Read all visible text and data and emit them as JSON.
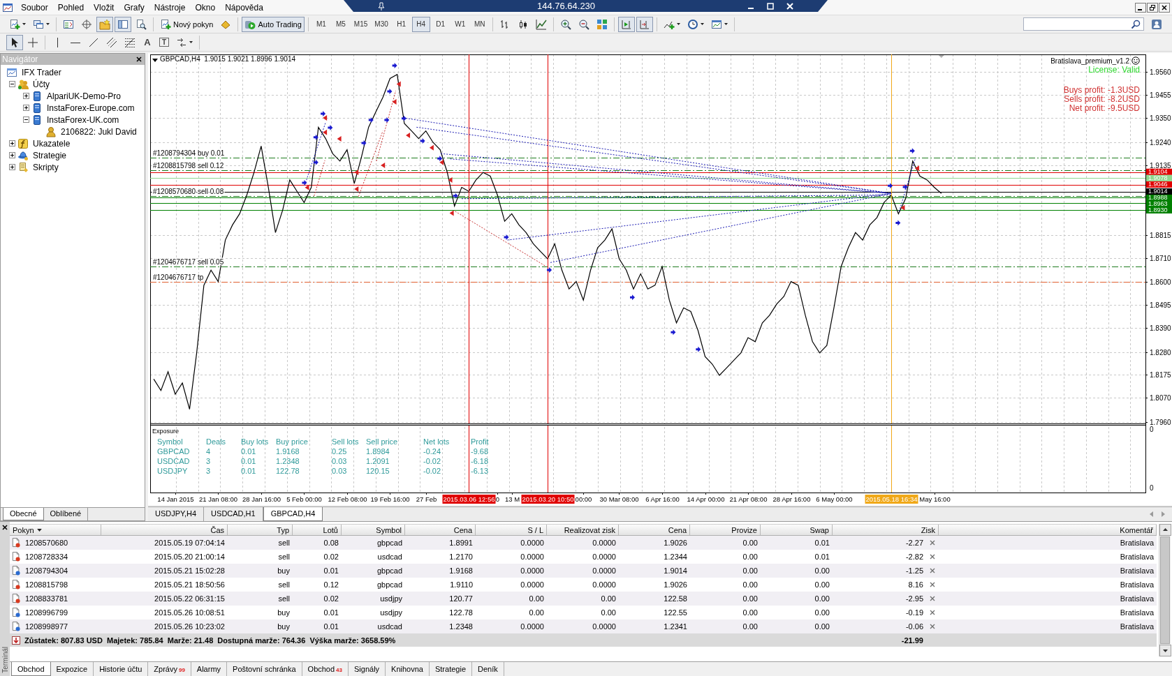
{
  "window": {
    "menu": [
      "Soubor",
      "Pohled",
      "Vložit",
      "Grafy",
      "Nástroje",
      "Okno",
      "Nápověda"
    ],
    "remote_title": "144.76.64.230"
  },
  "toolbar": [
    [
      {
        "kind": "icon",
        "caret": true,
        "pressed": false
      },
      {
        "kind": "icon",
        "caret": true,
        "pressed": false
      }
    ],
    [
      {
        "kind": "icon",
        "caret": false,
        "pressed": false
      },
      {
        "kind": "icon",
        "caret": false,
        "pressed": false
      },
      {
        "kind": "icon",
        "caret": false,
        "pressed": true
      },
      {
        "kind": "icon",
        "caret": false,
        "pressed": true
      },
      {
        "kind": "icon",
        "caret": false,
        "pressed": false
      }
    ],
    [
      {
        "kind": "labeled",
        "label": "Nový pokyn",
        "caret": false,
        "pressed": false
      },
      {
        "kind": "icon",
        "caret": false,
        "pressed": false
      }
    ],
    [
      {
        "kind": "labeled",
        "label": "Auto Trading",
        "caret": false,
        "pressed": true
      }
    ],
    [
      {
        "kind": "timeframe",
        "label": "M1",
        "selected": false
      },
      {
        "kind": "timeframe",
        "label": "M5",
        "selected": false
      },
      {
        "kind": "timeframe",
        "label": "M15",
        "selected": false
      },
      {
        "kind": "timeframe",
        "label": "M30",
        "selected": false
      },
      {
        "kind": "timeframe",
        "label": "H1",
        "selected": false
      },
      {
        "kind": "timeframe",
        "label": "H4",
        "selected": true
      },
      {
        "kind": "timeframe",
        "label": "D1",
        "selected": false
      },
      {
        "kind": "timeframe",
        "label": "W1",
        "selected": false
      },
      {
        "kind": "timeframe",
        "label": "MN",
        "selected": false
      }
    ],
    [
      {
        "kind": "icon",
        "caret": false,
        "pressed": false
      },
      {
        "kind": "icon",
        "caret": false,
        "pressed": false
      },
      {
        "kind": "icon",
        "caret": false,
        "pressed": false
      }
    ],
    [
      {
        "kind": "icon",
        "caret": false,
        "pressed": false
      },
      {
        "kind": "icon",
        "caret": false,
        "pressed": false
      },
      {
        "kind": "icon",
        "caret": false,
        "pressed": false
      }
    ],
    [
      {
        "kind": "icon",
        "caret": false,
        "pressed": true
      },
      {
        "kind": "icon",
        "caret": false,
        "pressed": true
      }
    ],
    [
      {
        "kind": "icon",
        "caret": true,
        "pressed": false
      },
      {
        "kind": "icon",
        "caret": true,
        "pressed": false
      },
      {
        "kind": "icon",
        "caret": true,
        "pressed": false
      }
    ]
  ],
  "drawing_tools": [
    [
      {
        "kind": "icon",
        "caret": false,
        "pressed": true
      },
      {
        "kind": "icon",
        "caret": false,
        "pressed": false
      }
    ],
    [
      {
        "kind": "icon",
        "caret": false,
        "pressed": false
      },
      {
        "kind": "icon",
        "caret": false,
        "pressed": false
      },
      {
        "kind": "icon",
        "caret": false,
        "pressed": false
      },
      {
        "kind": "icon",
        "caret": false,
        "pressed": false
      },
      {
        "kind": "icon",
        "caret": false,
        "pressed": false
      },
      {
        "kind": "glyph",
        "label": "A",
        "caret": false,
        "pressed": false
      },
      {
        "kind": "boxed",
        "label": "T",
        "caret": false,
        "pressed": false
      },
      {
        "kind": "icon",
        "caret": true,
        "pressed": false
      }
    ]
  ],
  "navigator": {
    "title": "Navigátor",
    "tree": [
      {
        "label": "IFX Trader",
        "kind": "terminal",
        "children": [
          {
            "label": "Účty",
            "kind": "accounts",
            "expanded": true,
            "children": [
              {
                "label": "AlpariUK-Demo-Pro",
                "kind": "server",
                "expanded": false
              },
              {
                "label": "InstaForex-Europe.com",
                "kind": "server",
                "expanded": false
              },
              {
                "label": "InstaForex-UK.com",
                "kind": "server",
                "expanded": true,
                "children": [
                  {
                    "label": "2106822: Jukl David",
                    "kind": "account"
                  }
                ]
              }
            ]
          },
          {
            "label": "Ukazatele",
            "kind": "indicators",
            "expanded": false
          },
          {
            "label": "Strategie",
            "kind": "experts",
            "expanded": false
          },
          {
            "label": "Skripty",
            "kind": "scripts",
            "expanded": false
          }
        ]
      }
    ],
    "tabs": [
      {
        "label": "Obecné",
        "selected": true
      },
      {
        "label": "Oblíbené",
        "selected": false
      }
    ]
  },
  "chart": {
    "tabs": [
      {
        "label": "USDJPY,H4",
        "selected": false
      },
      {
        "label": "USDCAD,H1",
        "selected": false
      },
      {
        "label": "GBPCAD,H4",
        "selected": true
      }
    ],
    "indicator": {
      "name": "Bratislava_premium_v1.2",
      "status": "License: Valid",
      "lines": [
        "Buys profit: -1.3USD",
        "Sells profit: -8.2USD",
        "Net profit: -9.5USD"
      ]
    },
    "chart_data": {
      "type": "line",
      "title": "GBPCAD,H4  1.9015 1.9021 1.8996 1.9014",
      "categories": [
        null,
        null,
        null,
        "14 Jan 2015",
        null,
        null,
        null,
        null,
        null,
        "21 Jan 08:00",
        null,
        null,
        null,
        null,
        null,
        "28 Jan 16:00",
        null,
        null,
        null,
        null,
        null,
        "5 Feb 00:00",
        null,
        null,
        null,
        null,
        null,
        "12 Feb 08:00",
        null,
        null,
        null,
        null,
        null,
        "19 Feb 16:00",
        null,
        null,
        null,
        null,
        "27 Feb",
        null,
        null,
        null,
        null,
        null,
        "2015.03.06 12:56",
        null,
        null,
        null,
        "0",
        null,
        "13 M",
        null,
        null,
        null,
        null,
        "2015.03.20 10:50",
        null,
        null,
        null,
        null,
        "00:00",
        null,
        null,
        null,
        null,
        "30 Mar 08:00",
        null,
        null,
        null,
        null,
        null,
        "6 Apr 16:00",
        null,
        null,
        null,
        null,
        null,
        "14 Apr 00:00",
        null,
        null,
        null,
        null,
        null,
        "21 Apr 08:00",
        null,
        null,
        null,
        null,
        null,
        "28 Apr 16:00",
        null,
        null,
        null,
        null,
        null,
        "6 May 00:00",
        null,
        null,
        null,
        null,
        null,
        null,
        null,
        "2015.05.18 16:34",
        null,
        null,
        null,
        null,
        null,
        "May 16:00",
        null,
        null,
        null,
        null,
        null,
        null,
        null,
        null,
        null,
        null,
        null,
        null,
        null,
        null,
        null,
        null,
        null,
        null,
        null,
        null,
        null,
        null,
        null,
        null,
        null,
        null,
        null,
        null,
        null
      ],
      "ylim": [
        1.7637,
        1.9641
      ],
      "grid": true,
      "yticks": [
        {
          "value": 1.956,
          "label": "1.9560"
        },
        {
          "value": 1.9455,
          "label": "1.9455"
        },
        {
          "value": 1.935,
          "label": "1.9350"
        },
        {
          "value": 1.924,
          "label": "1.9240"
        },
        {
          "value": 1.9135,
          "label": "1.9135"
        },
        {
          "value": 1.8815,
          "label": "1.8815"
        },
        {
          "value": 1.871,
          "label": "1.8710"
        },
        {
          "value": 1.86,
          "label": "1.8600"
        },
        {
          "value": 1.8495,
          "label": "1.8495"
        },
        {
          "value": 1.839,
          "label": "1.8390"
        },
        {
          "value": 1.828,
          "label": "1.8280"
        },
        {
          "value": 1.8175,
          "label": "1.8175"
        },
        {
          "value": 1.807,
          "label": "1.8070"
        },
        {
          "value": 1.796,
          "label": "1.7960"
        }
      ],
      "series": [
        {
          "color": "#000000",
          "values": [
            1.8156,
            1.8104,
            1.819,
            1.8087,
            1.8138,
            1.8018,
            1.8276,
            1.8585,
            1.8654,
            1.8602,
            1.8792,
            1.8861,
            1.8912,
            1.8998,
            1.9101,
            1.9222,
            1.9033,
            1.8826,
            1.8929,
            1.9067,
            1.9015,
            1.8964,
            1.9033,
            1.9308,
            1.9256,
            1.9187,
            1.9153,
            1.9205,
            1.905,
            1.917,
            1.9308,
            1.9377,
            1.9445,
            1.9531,
            1.9549,
            1.9325,
            1.9291,
            1.9256,
            1.9291,
            1.9239,
            1.9205,
            1.9101,
            1.8947,
            1.9033,
            1.9015,
            1.9067,
            1.9101,
            1.9084,
            1.8998,
            1.8878,
            1.8912,
            1.8861,
            1.8826,
            1.8775,
            1.874,
            1.8706,
            1.8775,
            1.8654,
            1.8568,
            1.8602,
            1.8517,
            1.8654,
            1.8757,
            1.8792,
            1.8843,
            1.8706,
            1.8654,
            1.8568,
            1.8637,
            1.8568,
            1.8585,
            1.8671,
            1.8517,
            1.8413,
            1.8482,
            1.8465,
            1.8379,
            1.8259,
            1.8224,
            1.8173,
            1.8207,
            1.8241,
            1.8276,
            1.8345,
            1.8327,
            1.8413,
            1.8448,
            1.8499,
            1.8534,
            1.8602,
            1.8585,
            1.8448,
            1.8327,
            1.8276,
            1.831,
            1.8482,
            1.8671,
            1.8757,
            1.8826,
            1.8792,
            1.8861,
            1.8895,
            1.8964,
            1.8998,
            1.8912,
            1.8981,
            1.9153,
            1.9084,
            1.9067,
            1.9033,
            1.9005,
            null,
            null,
            null,
            null,
            null,
            null,
            null,
            null,
            null,
            null,
            null,
            null,
            null,
            null,
            null,
            null,
            null,
            null,
            null,
            null,
            null,
            null,
            null,
            null,
            null,
            null,
            null,
            null
          ]
        }
      ],
      "ref_lines": [
        {
          "axis": "y",
          "value": 1.9168,
          "label": "#1208794304 buy 0.01",
          "color": "#1e7b1e"
        },
        {
          "axis": "y",
          "value": 1.911,
          "label": "#1208815798 sell 0.12",
          "color": "#1e7b1e"
        },
        {
          "axis": "y",
          "value": 1.9104,
          "color": "#e00000"
        },
        {
          "axis": "y",
          "value": 1.9078,
          "color": "#8fd88f"
        },
        {
          "axis": "y",
          "value": 1.9046,
          "color": "#e00000"
        },
        {
          "axis": "y",
          "value": 1.9014,
          "color": "#000000"
        },
        {
          "axis": "y",
          "value": 1.8991,
          "label": "#1208570680 sell 0.08",
          "color": "#1e7b1e"
        },
        {
          "axis": "y",
          "value": 1.8988,
          "color": "#008000"
        },
        {
          "axis": "y",
          "value": 1.8963,
          "color": "#008000"
        },
        {
          "axis": "y",
          "value": 1.893,
          "color": "#008000"
        },
        {
          "axis": "y",
          "value": 1.8668,
          "label": "#1204676717 sell 0.05",
          "color": "#1e7b1e"
        },
        {
          "axis": "y",
          "value": 1.86,
          "label": "#1204676717 tp",
          "color": "#e06030"
        }
      ],
      "annotations": [
        "1.9104",
        "1.9078",
        "1.9046",
        "1.9014",
        "1.8988",
        "1.8963",
        "1.8930"
      ]
    },
    "exposure": {
      "title": "Exposure",
      "columns": [
        "Symbol",
        "Deals",
        "Buy lots",
        "Buy price",
        "Sell lots",
        "Sell price",
        "Net lots",
        "Profit"
      ],
      "rows": [
        [
          "GBPCAD",
          "4",
          "0.01",
          "1.9168",
          "0.25",
          "1.8984",
          "-0.24",
          "-9.68"
        ],
        [
          "USDCAD",
          "3",
          "0.01",
          "1.2348",
          "0.03",
          "1.2091",
          "-0.02",
          "-6.18"
        ],
        [
          "USDJPY",
          "3",
          "0.01",
          "122.78",
          "0.03",
          "120.15",
          "-0.02",
          "-6.13"
        ]
      ],
      "axis": [
        "0",
        "0"
      ]
    }
  },
  "terminal": {
    "title": "Terminál",
    "columns": [
      {
        "label": "Pokyn",
        "sorted": true
      },
      {
        "label": "Čas",
        "sorted": false
      },
      {
        "label": "Typ",
        "sorted": false
      },
      {
        "label": "Lotů",
        "sorted": false
      },
      {
        "label": "Symbol",
        "sorted": false
      },
      {
        "label": "Cena",
        "sorted": false
      },
      {
        "label": "S / L",
        "sorted": false
      },
      {
        "label": "Realizovat zisk",
        "sorted": false
      },
      {
        "label": "Cena",
        "sorted": false
      },
      {
        "label": "Provize",
        "sorted": false
      },
      {
        "label": "Swap",
        "sorted": false
      },
      {
        "label": "Zisk",
        "sorted": false
      },
      {
        "label": "Komentář",
        "sorted": false
      }
    ],
    "rows": [
      {
        "kind": "sell",
        "cells": [
          "1208570680",
          "2015.05.19 07:04:14",
          "sell",
          "0.08",
          "gbpcad",
          "1.8991",
          "0.0000",
          "0.0000",
          "1.9026",
          "0.00",
          "0.01",
          "-2.27",
          "Bratislava"
        ]
      },
      {
        "kind": "sell",
        "cells": [
          "1208728334",
          "2015.05.20 21:00:14",
          "sell",
          "0.02",
          "usdcad",
          "1.2170",
          "0.0000",
          "0.0000",
          "1.2344",
          "0.00",
          "0.01",
          "-2.82",
          "Bratislava"
        ]
      },
      {
        "kind": "buy",
        "cells": [
          "1208794304",
          "2015.05.21 15:02:28",
          "buy",
          "0.01",
          "gbpcad",
          "1.9168",
          "0.0000",
          "0.0000",
          "1.9014",
          "0.00",
          "0.00",
          "-1.25",
          "Bratislava"
        ]
      },
      {
        "kind": "sell",
        "cells": [
          "1208815798",
          "2015.05.21 18:50:56",
          "sell",
          "0.12",
          "gbpcad",
          "1.9110",
          "0.0000",
          "0.0000",
          "1.9026",
          "0.00",
          "0.00",
          "8.16",
          "Bratislava"
        ]
      },
      {
        "kind": "sell",
        "cells": [
          "1208833781",
          "2015.05.22 06:31:15",
          "sell",
          "0.02",
          "usdjpy",
          "120.77",
          "0.00",
          "0.00",
          "122.58",
          "0.00",
          "0.00",
          "-2.95",
          "Bratislava"
        ]
      },
      {
        "kind": "buy",
        "cells": [
          "1208996799",
          "2015.05.26 10:08:51",
          "buy",
          "0.01",
          "usdjpy",
          "122.78",
          "0.00",
          "0.00",
          "122.55",
          "0.00",
          "0.00",
          "-0.19",
          "Bratislava"
        ]
      },
      {
        "kind": "buy",
        "cells": [
          "1208998977",
          "2015.05.26 10:23:02",
          "buy",
          "0.01",
          "usdcad",
          "1.2348",
          "0.0000",
          "0.0000",
          "1.2341",
          "0.00",
          "0.00",
          "-0.06",
          "Bratislava"
        ]
      }
    ],
    "summary": {
      "text": "Zůstatek: 807.83 USD  Majetek: 785.84  Marže: 21.48  Dostupná marže: 764.36  Výška marže: 3658.59%",
      "total": "-21.99"
    },
    "tabs": [
      {
        "label": "Obchod",
        "selected": true
      },
      {
        "label": "Expozice",
        "selected": false
      },
      {
        "label": "Historie účtu",
        "selected": false
      },
      {
        "label": "Zprávy",
        "badge": "99",
        "selected": false
      },
      {
        "label": "Alarmy",
        "selected": false
      },
      {
        "label": "Poštovní schránka",
        "selected": false
      },
      {
        "label": "Obchod",
        "badge": "43",
        "selected": false
      },
      {
        "label": "Signály",
        "selected": false
      },
      {
        "label": "Knihovna",
        "selected": false
      },
      {
        "label": "Strategie",
        "selected": false
      },
      {
        "label": "Deník",
        "selected": false
      }
    ]
  }
}
